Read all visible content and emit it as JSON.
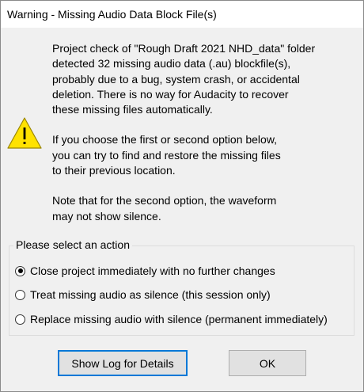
{
  "window": {
    "title": "Warning - Missing Audio Data Block File(s)"
  },
  "icons": {
    "warning": "warning-triangle-icon",
    "warning_color": "#ffe200"
  },
  "message": {
    "paragraph_1": "Project check of \"Rough Draft 2021 NHD_data\" folder\ndetected 32 missing audio data (.au) blockfile(s),\nprobably due to a bug, system crash, or accidental\ndeletion. There is no way for Audacity to recover\nthese missing files automatically.",
    "paragraph_2": "If you choose the first or second option below,\nyou can try to find and restore the missing files\nto their previous location.",
    "paragraph_3": "Note that for the second option, the waveform\nmay not show silence."
  },
  "action_group": {
    "label": "Please select an action",
    "options": [
      {
        "label": "Close project immediately with no further changes",
        "selected": true
      },
      {
        "label": "Treat missing audio as silence (this session only)",
        "selected": false
      },
      {
        "label": "Replace missing audio with silence (permanent immediately)",
        "selected": false
      }
    ]
  },
  "buttons": {
    "show_log": "Show Log for Details",
    "ok": "OK"
  },
  "colors": {
    "focus_border": "#0078d7",
    "button_face": "#e1e1e1",
    "dialog_bg": "#f0f0f0"
  }
}
